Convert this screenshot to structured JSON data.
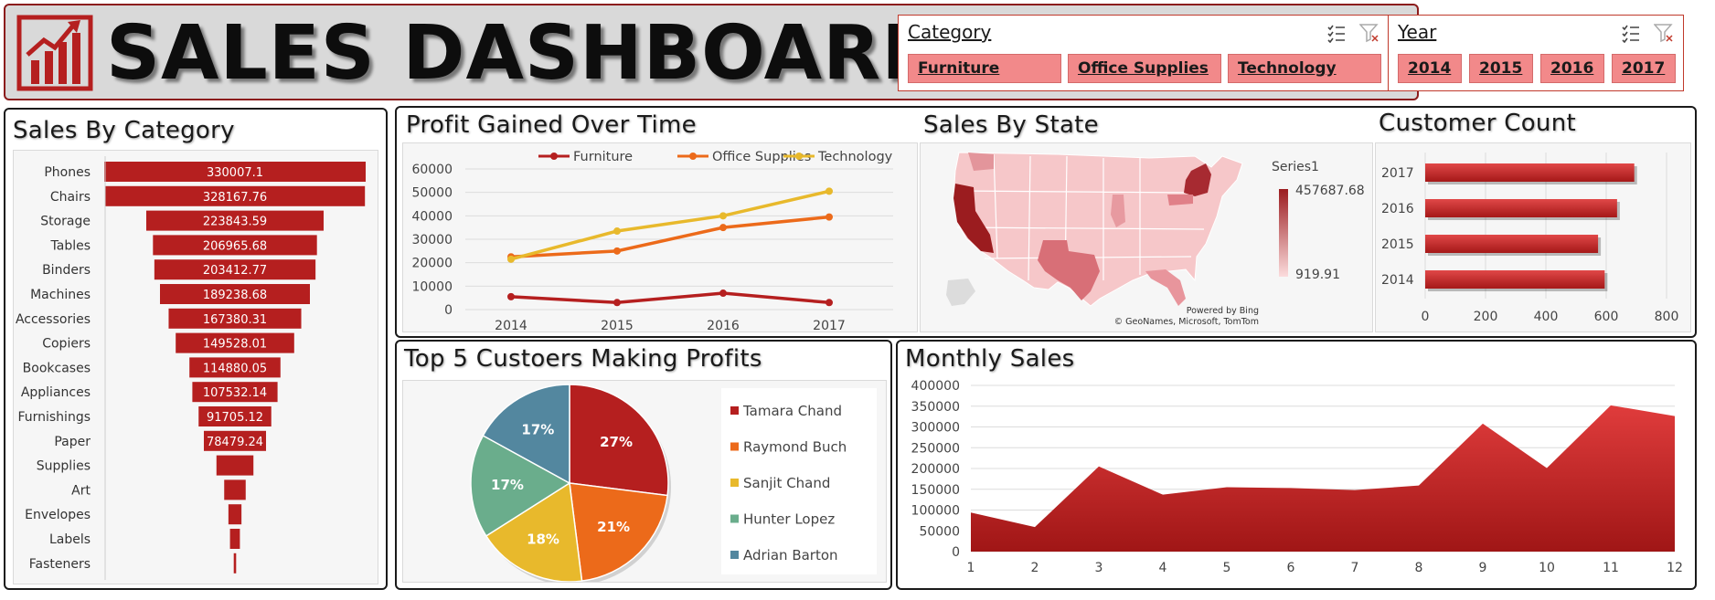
{
  "header": {
    "title": "SALES DASHBOARD",
    "category_slicer": {
      "title": "Category",
      "items": [
        "Furniture",
        "Office Supplies",
        "Technology"
      ]
    },
    "year_slicer": {
      "title": "Year",
      "items": [
        "2014",
        "2015",
        "2016",
        "2017"
      ]
    },
    "icons": {
      "logo": "bar-chart-logo-icon",
      "multiselect": "multi-select-icon",
      "clear_filter": "clear-filter-icon"
    }
  },
  "colors": {
    "accent": "#b51f1f",
    "furniture": "#b51f1f",
    "office_supplies": "#ec6a1a",
    "technology": "#e8b92c",
    "slicer_button": "#f2898a",
    "pie": [
      "#b51f1f",
      "#ec6a1a",
      "#e8b92c",
      "#6aad8c",
      "#53879f"
    ]
  },
  "panels": {
    "sales_by_category": "Sales By Category",
    "profit_over_time": "Profit Gained Over Time",
    "sales_by_state": "Sales By State",
    "customer_count": "Customer Count",
    "top_customers": "Top 5 Custoers Making Profits",
    "monthly_sales": "Monthly Sales"
  },
  "map": {
    "legend_series": "Series1",
    "legend_max": "457687.68",
    "legend_min": "919.91",
    "powered_by": "Powered by Bing",
    "credits": "© GeoNames, Microsoft, TomTom"
  },
  "chart_data": [
    {
      "id": "sales_by_category",
      "type": "bar",
      "orientation": "horizontal-funnel",
      "categories": [
        "Phones",
        "Chairs",
        "Storage",
        "Tables",
        "Binders",
        "Machines",
        "Accessories",
        "Copiers",
        "Bookcases",
        "Appliances",
        "Furnishings",
        "Paper",
        "Supplies",
        "Art",
        "Envelopes",
        "Labels",
        "Fasteners"
      ],
      "values": [
        330007.1,
        328167.76,
        223843.59,
        206965.68,
        203412.77,
        189238.68,
        167380.31,
        149528.01,
        114880.05,
        107532.14,
        91705.12,
        78479.24,
        46673.54,
        27118.79,
        16476.4,
        12486.31,
        3024.28
      ],
      "data_labels": [
        "330007.1",
        "328167.76",
        "223843.59",
        "206965.68",
        "203412.77",
        "189238.68",
        "167380.31",
        "149528.01",
        "114880.05",
        "107532.14",
        "91705.12",
        "78479.24",
        "",
        "",
        "",
        "",
        ""
      ]
    },
    {
      "id": "profit_over_time",
      "type": "line",
      "categories": [
        "2014",
        "2015",
        "2016",
        "2017"
      ],
      "series": [
        {
          "name": "Furniture",
          "values": [
            5500,
            3000,
            7000,
            3000
          ]
        },
        {
          "name": "Office Supplies",
          "values": [
            22500,
            25000,
            35000,
            39500
          ]
        },
        {
          "name": "Technology",
          "values": [
            21500,
            33500,
            40000,
            50500
          ]
        }
      ],
      "ylim": [
        0,
        60000
      ],
      "yticks": [
        0,
        10000,
        20000,
        30000,
        40000,
        50000,
        60000
      ],
      "legend": "top",
      "grid": true
    },
    {
      "id": "customer_count",
      "type": "bar",
      "orientation": "horizontal",
      "categories": [
        "2017",
        "2016",
        "2015",
        "2014"
      ],
      "values": [
        693,
        636,
        573,
        595
      ],
      "xlim": [
        0,
        800
      ],
      "xticks": [
        0,
        200,
        400,
        600,
        800
      ],
      "grid": true
    },
    {
      "id": "top_customers",
      "type": "pie",
      "labels": [
        "Tamara Chand",
        "Raymond Buch",
        "Sanjit Chand",
        "Hunter Lopez",
        "Adrian Barton"
      ],
      "values": [
        27,
        21,
        18,
        17,
        17
      ],
      "data_labels": [
        "27%",
        "21%",
        "18%",
        "17%",
        "17%"
      ],
      "legend": "right"
    },
    {
      "id": "monthly_sales",
      "type": "area",
      "x": [
        1,
        2,
        3,
        4,
        5,
        6,
        7,
        8,
        9,
        10,
        11,
        12
      ],
      "values": [
        94000,
        59000,
        205000,
        137000,
        155000,
        153000,
        148000,
        159000,
        308000,
        201000,
        352000,
        326000
      ],
      "ylim": [
        0,
        400000
      ],
      "yticks": [
        0,
        50000,
        100000,
        150000,
        200000,
        250000,
        300000,
        350000,
        400000
      ],
      "grid": true
    }
  ]
}
